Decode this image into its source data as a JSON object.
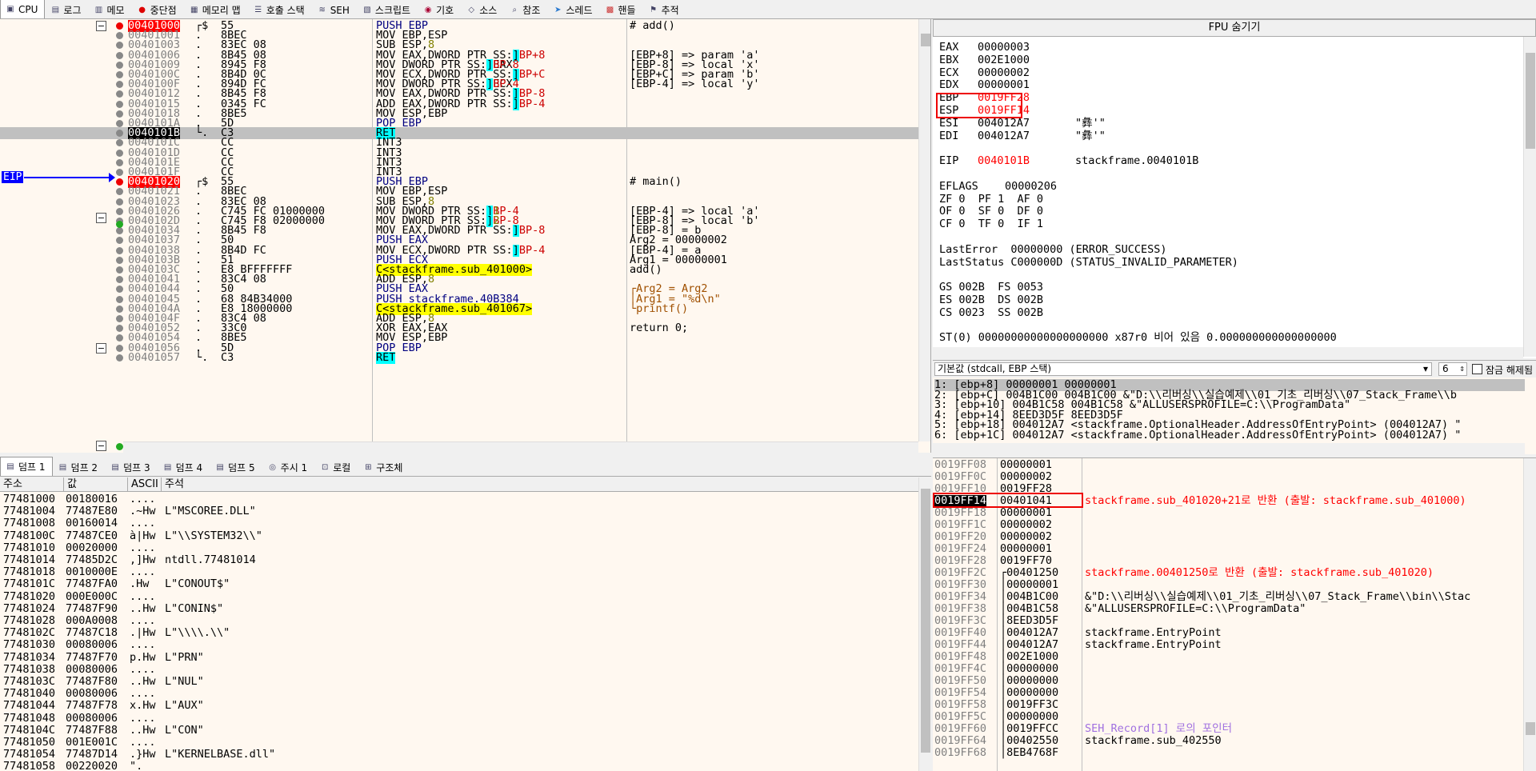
{
  "top_tabs": [
    {
      "label": "CPU",
      "icon": "cpu-icon"
    },
    {
      "label": "로그",
      "icon": "log-icon"
    },
    {
      "label": "메모",
      "icon": "notes-icon"
    },
    {
      "label": "중단점",
      "icon": "breakpoint-icon"
    },
    {
      "label": "메모리 맵",
      "icon": "memory-map-icon"
    },
    {
      "label": "호출 스택",
      "icon": "call-stack-icon"
    },
    {
      "label": "SEH",
      "icon": "seh-icon"
    },
    {
      "label": "스크립트",
      "icon": "script-icon"
    },
    {
      "label": "기호",
      "icon": "symbols-icon"
    },
    {
      "label": "소스",
      "icon": "source-icon"
    },
    {
      "label": "참조",
      "icon": "references-icon"
    },
    {
      "label": "스레드",
      "icon": "threads-icon"
    },
    {
      "label": "핸들",
      "icon": "handles-icon"
    },
    {
      "label": "추적",
      "icon": "trace-icon"
    }
  ],
  "disasm": {
    "eip_label": "EIP",
    "rows": [
      {
        "addr": "00401000",
        "mk": "┌$",
        "bytes": "55",
        "asm": "PUSH EBP",
        "cmt": "# add()",
        "addr_style": "red"
      },
      {
        "addr": "00401001",
        "mk": ".",
        "bytes": "8BEC",
        "asm": "MOV EBP,ESP",
        "cmt": ""
      },
      {
        "addr": "00401003",
        "mk": ".",
        "bytes": "83EC 08",
        "asm": "SUB ESP,8",
        "cmt": ""
      },
      {
        "addr": "00401006",
        "mk": ".",
        "bytes": "8B45 08",
        "asm": "MOV EAX,DWORD PTR SS:[EBP+8]",
        "cmt": "[EBP+8] => param 'a'"
      },
      {
        "addr": "00401009",
        "mk": ".",
        "bytes": "8945 F8",
        "asm": "MOV DWORD PTR SS:[EBP-8],EAX",
        "cmt": "[EBP-8] => local 'x'"
      },
      {
        "addr": "0040100C",
        "mk": ".",
        "bytes": "8B4D 0C",
        "asm": "MOV ECX,DWORD PTR SS:[EBP+C]",
        "cmt": "[EBP+C] => param 'b'"
      },
      {
        "addr": "0040100F",
        "mk": ".",
        "bytes": "894D FC",
        "asm": "MOV DWORD PTR SS:[EBP-4],ECX",
        "cmt": "[EBP-4] => local 'y'"
      },
      {
        "addr": "00401012",
        "mk": ".",
        "bytes": "8B45 F8",
        "asm": "MOV EAX,DWORD PTR SS:[EBP-8]",
        "cmt": ""
      },
      {
        "addr": "00401015",
        "mk": ".",
        "bytes": "0345 FC",
        "asm": "ADD EAX,DWORD PTR SS:[EBP-4]",
        "cmt": ""
      },
      {
        "addr": "00401018",
        "mk": ".",
        "bytes": "8BE5",
        "asm": "MOV ESP,EBP",
        "cmt": ""
      },
      {
        "addr": "0040101A",
        "mk": ".",
        "bytes": "5D",
        "asm": "POP EBP",
        "cmt": ""
      },
      {
        "addr": "0040101B",
        "mk": "└.",
        "bytes": "C3",
        "asm": "RET",
        "cmt": "",
        "current": true
      },
      {
        "addr": "0040101C",
        "mk": "",
        "bytes": "CC",
        "asm": "INT3",
        "cmt": ""
      },
      {
        "addr": "0040101D",
        "mk": "",
        "bytes": "CC",
        "asm": "INT3",
        "cmt": ""
      },
      {
        "addr": "0040101E",
        "mk": "",
        "bytes": "CC",
        "asm": "INT3",
        "cmt": ""
      },
      {
        "addr": "0040101F",
        "mk": "",
        "bytes": "CC",
        "asm": "INT3",
        "cmt": ""
      },
      {
        "addr": "00401020",
        "mk": "┌$",
        "bytes": "55",
        "asm": "PUSH EBP",
        "cmt": "# main()",
        "addr_style": "red"
      },
      {
        "addr": "00401021",
        "mk": ".",
        "bytes": "8BEC",
        "asm": "MOV EBP,ESP",
        "cmt": ""
      },
      {
        "addr": "00401023",
        "mk": ".",
        "bytes": "83EC 08",
        "asm": "SUB ESP,8",
        "cmt": ""
      },
      {
        "addr": "00401026",
        "mk": ".",
        "bytes": "C745 FC 01000000",
        "asm": "MOV DWORD PTR SS:[EBP-4],1",
        "cmt": "[EBP-4] => local 'a'"
      },
      {
        "addr": "0040102D",
        "mk": ".",
        "bytes": "C745 F8 02000000",
        "asm": "MOV DWORD PTR SS:[EBP-8],2",
        "cmt": "[EBP-8] => local 'b'"
      },
      {
        "addr": "00401034",
        "mk": ".",
        "bytes": "8B45 F8",
        "asm": "MOV EAX,DWORD PTR SS:[EBP-8]",
        "cmt": "[EBP-8] = b"
      },
      {
        "addr": "00401037",
        "mk": ".",
        "bytes": "50",
        "asm": "PUSH EAX",
        "cmt": "Arg2 = 00000002"
      },
      {
        "addr": "00401038",
        "mk": ".",
        "bytes": "8B4D FC",
        "asm": "MOV ECX,DWORD PTR SS:[EBP-4]",
        "cmt": "[EBP-4] = a"
      },
      {
        "addr": "0040103B",
        "mk": ".",
        "bytes": "51",
        "asm": "PUSH ECX",
        "cmt": "Arg1 = 00000001"
      },
      {
        "addr": "0040103C",
        "mk": ".",
        "bytes": "E8 BFFFFFFF",
        "asm": "CALL <stackframe.sub_401000>",
        "cmt": "add()"
      },
      {
        "addr": "00401041",
        "mk": ".",
        "bytes": "83C4 08",
        "asm": "ADD ESP,8",
        "cmt": ""
      },
      {
        "addr": "00401044",
        "mk": ".",
        "bytes": "50",
        "asm": "PUSH EAX",
        "cmt": "┌Arg2 = Arg2"
      },
      {
        "addr": "00401045",
        "mk": ".",
        "bytes": "68 84B34000",
        "asm": "PUSH stackframe.40B384",
        "cmt": "│Arg1 = \"%d\\n\""
      },
      {
        "addr": "0040104A",
        "mk": ".",
        "bytes": "E8 18000000",
        "asm": "CALL <stackframe.sub_401067>",
        "cmt": "└printf()"
      },
      {
        "addr": "0040104F",
        "mk": ".",
        "bytes": "83C4 08",
        "asm": "ADD ESP,8",
        "cmt": ""
      },
      {
        "addr": "00401052",
        "mk": ".",
        "bytes": "33C0",
        "asm": "XOR EAX,EAX",
        "cmt": "return 0;"
      },
      {
        "addr": "00401054",
        "mk": ".",
        "bytes": "8BE5",
        "asm": "MOV ESP,EBP",
        "cmt": ""
      },
      {
        "addr": "00401056",
        "mk": ".",
        "bytes": "5D",
        "asm": "POP EBP",
        "cmt": ""
      },
      {
        "addr": "00401057",
        "mk": "└.",
        "bytes": "C3",
        "asm": "RET",
        "cmt": ""
      }
    ]
  },
  "registers": {
    "title": "FPU 숨기기",
    "lines": [
      {
        "name": "EAX",
        "value": "00000003",
        "extra": ""
      },
      {
        "name": "EBX",
        "value": "002E1000",
        "extra": ""
      },
      {
        "name": "ECX",
        "value": "00000002",
        "extra": ""
      },
      {
        "name": "EDX",
        "value": "00000001",
        "extra": ""
      },
      {
        "name": "EBP",
        "value": "0019FF28",
        "extra": "",
        "red": true
      },
      {
        "name": "ESP",
        "value": "0019FF14",
        "extra": "",
        "red": true
      },
      {
        "name": "ESI",
        "value": "004012A7",
        "extra": "\"彝'\""
      },
      {
        "name": "EDI",
        "value": "004012A7",
        "extra": "\"彝'\""
      },
      {
        "name": "EIP",
        "value": "0040101B",
        "extra": "stackframe.0040101B",
        "red": true
      },
      {
        "name": "EFLAGS",
        "value": "00000206",
        "extra": ""
      }
    ],
    "flags": [
      "ZF 0  PF 1  AF 0",
      "OF 0  SF 0  DF 0",
      "CF 0  TF 0  IF 1"
    ],
    "last_error": "LastError  00000000 (ERROR_SUCCESS)",
    "last_status": "LastStatus C000000D (STATUS_INVALID_PARAMETER)",
    "segments": [
      "GS 002B  FS 0053",
      "ES 002B  DS 002B",
      "CS 0023  SS 002B"
    ],
    "st0": "ST(0) 00000000000000000000 x87r0 비어 있음 0.000000000000000000"
  },
  "callconv": {
    "selected": "기본값 (stdcall, EBP 스택)",
    "count": "6",
    "lock_label": "잠금 해제됨"
  },
  "stack_args": [
    "1: [ebp+8] 00000001 00000001",
    "2: [ebp+C] 004B1C00 004B1C00 &\"D:\\\\리버싱\\\\실습예제\\\\01_기초_리버싱\\\\07_Stack_Frame\\\\b",
    "3: [ebp+10] 004B1C58 004B1C58 &\"ALLUSERSPROFILE=C:\\\\ProgramData\"",
    "4: [ebp+14] 8EED3D5F 8EED3D5F",
    "5: [ebp+18] 004012A7 <stackframe.OptionalHeader.AddressOfEntryPoint> (004012A7) \"",
    "6: [ebp+1C] 004012A7 <stackframe.OptionalHeader.AddressOfEntryPoint> (004012A7) \""
  ],
  "dump_tabs": [
    {
      "label": "덤프 1",
      "icon": "dump-icon"
    },
    {
      "label": "덤프 2",
      "icon": "dump-icon"
    },
    {
      "label": "덤프 3",
      "icon": "dump-icon"
    },
    {
      "label": "덤프 4",
      "icon": "dump-icon"
    },
    {
      "label": "덤프 5",
      "icon": "dump-icon"
    },
    {
      "label": "주시 1",
      "icon": "watch-icon"
    },
    {
      "label": "로컬",
      "icon": "locals-icon"
    },
    {
      "label": "구조체",
      "icon": "struct-icon"
    }
  ],
  "dump": {
    "headers": [
      "주소",
      "값",
      "ASCII",
      "주석"
    ],
    "rows": [
      [
        "77481000",
        "00180016",
        "....",
        ""
      ],
      [
        "77481004",
        "77487E80",
        ".~Hw",
        "L\"MSCOREE.DLL\""
      ],
      [
        "77481008",
        "00160014",
        "....",
        ""
      ],
      [
        "7748100C",
        "77487CE0",
        "à|Hw",
        "L\"\\\\SYSTEM32\\\\\""
      ],
      [
        "77481010",
        "00020000",
        "....",
        ""
      ],
      [
        "77481014",
        "77485D2C",
        ",]Hw",
        "ntdll.77481014"
      ],
      [
        "77481018",
        "0010000E",
        "....",
        ""
      ],
      [
        "7748101C",
        "77487FA0",
        ".Hw",
        "L\"CONOUT$\""
      ],
      [
        "77481020",
        "000E000C",
        "....",
        ""
      ],
      [
        "77481024",
        "77487F90",
        "..Hw",
        "L\"CONIN$\""
      ],
      [
        "77481028",
        "000A0008",
        "....",
        ""
      ],
      [
        "7748102C",
        "77487C18",
        ".|Hw",
        "L\"\\\\\\\\.\\\\\""
      ],
      [
        "77481030",
        "00080006",
        "....",
        ""
      ],
      [
        "77481034",
        "77487F70",
        "p.Hw",
        "L\"PRN\""
      ],
      [
        "77481038",
        "00080006",
        "....",
        ""
      ],
      [
        "7748103C",
        "77487F80",
        "..Hw",
        "L\"NUL\""
      ],
      [
        "77481040",
        "00080006",
        "....",
        ""
      ],
      [
        "77481044",
        "77487F78",
        "x.Hw",
        "L\"AUX\""
      ],
      [
        "77481048",
        "00080006",
        "....",
        ""
      ],
      [
        "7748104C",
        "77487F88",
        "..Hw",
        "L\"CON\""
      ],
      [
        "77481050",
        "001E001C",
        "....",
        ""
      ],
      [
        "77481054",
        "77487D14",
        ".}Hw",
        "L\"KERNELBASE.dll\""
      ],
      [
        "77481058",
        "00220020",
        "\".",
        " "
      ]
    ]
  },
  "stack": {
    "rows": [
      {
        "addr": "0019FF08",
        "val": "00000001",
        "cm": ""
      },
      {
        "addr": "0019FF0C",
        "val": "00000002",
        "cm": ""
      },
      {
        "addr": "0019FF10",
        "val": "0019FF28",
        "cm": ""
      },
      {
        "addr": "0019FF14",
        "val": "00401041",
        "cm": "stackframe.sub_401020+21로 반환 (출발: stackframe.sub_401000)",
        "current": true,
        "cm_style": "red"
      },
      {
        "addr": "0019FF18",
        "val": "00000001",
        "cm": ""
      },
      {
        "addr": "0019FF1C",
        "val": "00000002",
        "cm": ""
      },
      {
        "addr": "0019FF20",
        "val": "00000002",
        "cm": ""
      },
      {
        "addr": "0019FF24",
        "val": "00000001",
        "cm": ""
      },
      {
        "addr": "0019FF28",
        "val": "0019FF70",
        "cm": ""
      },
      {
        "addr": "0019FF2C",
        "val": "┌00401250",
        "cm": "stackframe.00401250로 반환 (출발: stackframe.sub_401020)",
        "cm_style": "red"
      },
      {
        "addr": "0019FF30",
        "val": "│00000001",
        "cm": ""
      },
      {
        "addr": "0019FF34",
        "val": "│004B1C00",
        "cm": "&\"D:\\\\리버싱\\\\실습예제\\\\01_기초_리버싱\\\\07_Stack_Frame\\\\bin\\\\Stac"
      },
      {
        "addr": "0019FF38",
        "val": "│004B1C58",
        "cm": "&\"ALLUSERSPROFILE=C:\\\\ProgramData\""
      },
      {
        "addr": "0019FF3C",
        "val": "│8EED3D5F",
        "cm": ""
      },
      {
        "addr": "0019FF40",
        "val": "│004012A7",
        "cm": "stackframe.EntryPoint",
        "addr_style": "red"
      },
      {
        "addr": "0019FF44",
        "val": "│004012A7",
        "cm": "stackframe.EntryPoint",
        "addr_style": "red"
      },
      {
        "addr": "0019FF48",
        "val": "│002E1000",
        "cm": ""
      },
      {
        "addr": "0019FF4C",
        "val": "│00000000",
        "cm": ""
      },
      {
        "addr": "0019FF50",
        "val": "│00000000",
        "cm": ""
      },
      {
        "addr": "0019FF54",
        "val": "│00000000",
        "cm": ""
      },
      {
        "addr": "0019FF58",
        "val": "│0019FF3C",
        "cm": ""
      },
      {
        "addr": "0019FF5C",
        "val": "│00000000",
        "cm": ""
      },
      {
        "addr": "0019FF60",
        "val": "│0019FFCC",
        "cm": "SEH_Record[1] 로의 포인터",
        "cm_style": "purple"
      },
      {
        "addr": "0019FF64",
        "val": "│00402550",
        "cm": "stackframe.sub_402550",
        "addr_style": "red"
      },
      {
        "addr": "0019FF68",
        "val": "│8EB4768F",
        "cm": ""
      }
    ]
  }
}
